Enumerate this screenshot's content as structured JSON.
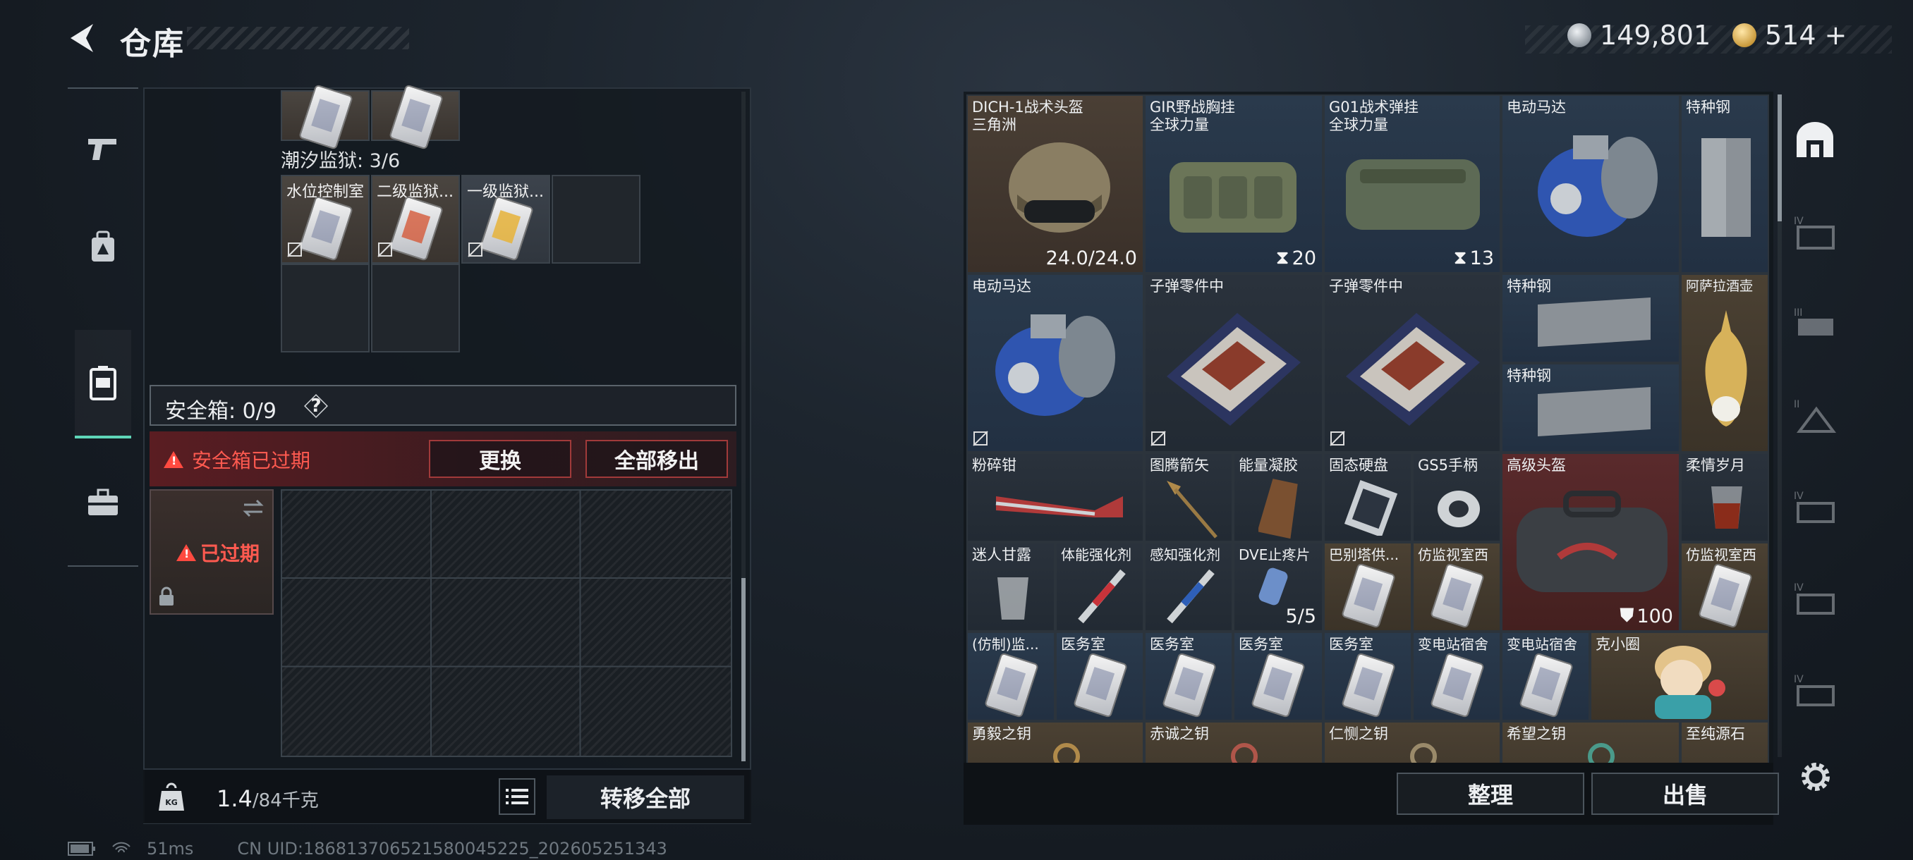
{
  "header": {
    "title": "仓库",
    "currency": [
      {
        "icon": "silver-coin-icon",
        "value": "149,801"
      },
      {
        "icon": "gold-coin-icon",
        "value": "514"
      }
    ],
    "add_label": "+"
  },
  "left_nav": [
    {
      "icon": "pistol-icon"
    },
    {
      "icon": "backpack-icon"
    },
    {
      "icon": "safe-box-icon",
      "active": true
    },
    {
      "icon": "toolbox-icon"
    }
  ],
  "stash": {
    "section_label": "潮汐监狱: 3/6",
    "cells": [
      "水位控制室",
      "二级监狱...",
      "一级监狱..."
    ]
  },
  "safe": {
    "label": "安全箱: 0/9",
    "help": "?",
    "warning": "安全箱已过期",
    "replace_button": "更换",
    "move_all_button": "全部移出",
    "expired_label": "已过期"
  },
  "footer_left": {
    "weight": "1.4",
    "capacity": "/84千克",
    "transfer_all": "转移全部"
  },
  "status": {
    "ping": "51ms",
    "uid": "CN UID:18681370652158004522​5_202605251343"
  },
  "inventory": {
    "items": [
      {
        "name": "DICH-1战术头盔",
        "sub": "三角洲",
        "count": "24.0/24.0"
      },
      {
        "name": "GIR野战胸挂",
        "sub": "全球力量",
        "count": "20"
      },
      {
        "name": "G01战术弹挂",
        "sub": "全球力量",
        "count": "13"
      },
      {
        "name": "电动马达"
      },
      {
        "name": "特种钢"
      },
      {
        "name": "电动马达"
      },
      {
        "name": "子弹零件中"
      },
      {
        "name": "子弹零件中"
      },
      {
        "name": "特种钢"
      },
      {
        "name": "特种钢"
      },
      {
        "name": "阿萨拉酒壶"
      },
      {
        "name": "粉碎钳"
      },
      {
        "name": "图腾箭矢"
      },
      {
        "name": "能量凝胶"
      },
      {
        "name": "固态硬盘"
      },
      {
        "name": "GS5手柄"
      },
      {
        "name": "高级头盔",
        "count": "100"
      },
      {
        "name": "柔情岁月"
      },
      {
        "name": "迷人甘露"
      },
      {
        "name": "体能强化剂"
      },
      {
        "name": "感知强化剂"
      },
      {
        "name": "DVE止疼片",
        "count": "5/5"
      },
      {
        "name": "巴别塔供..."
      },
      {
        "name": "仿监视室西"
      },
      {
        "name": "仿监视室西"
      },
      {
        "name": "(仿制)监..."
      },
      {
        "name": "医务室"
      },
      {
        "name": "医务室"
      },
      {
        "name": "医务室"
      },
      {
        "name": "医务室"
      },
      {
        "name": "变电站宿舍"
      },
      {
        "name": "变电站宿舍"
      },
      {
        "name": "克小圈"
      },
      {
        "name": "勇毅之钥"
      },
      {
        "name": "赤诚之钥"
      },
      {
        "name": "仁恻之钥"
      },
      {
        "name": "希望之钥"
      },
      {
        "name": "至纯源石"
      }
    ],
    "sort_button": "整理",
    "sell_button": "出售"
  },
  "right_nav": [
    {
      "icon": "stash-tab-icon",
      "active": true
    },
    {
      "icon": "stash-iv-tab-icon",
      "badge": "IV"
    },
    {
      "icon": "stash-iii-tab-icon",
      "badge": "III"
    },
    {
      "icon": "stash-ii-tab-icon",
      "badge": "II"
    },
    {
      "icon": "stash-iv-b-tab-icon",
      "badge": "IV"
    },
    {
      "icon": "stash-iv-c-tab-icon",
      "badge": "IV"
    },
    {
      "icon": "stash-iv-d-tab-icon",
      "badge": "IV"
    }
  ],
  "colors": {
    "accent": "#5fd6b8",
    "warning": "#ff5a50",
    "warning_bg": "#5a1d22"
  }
}
